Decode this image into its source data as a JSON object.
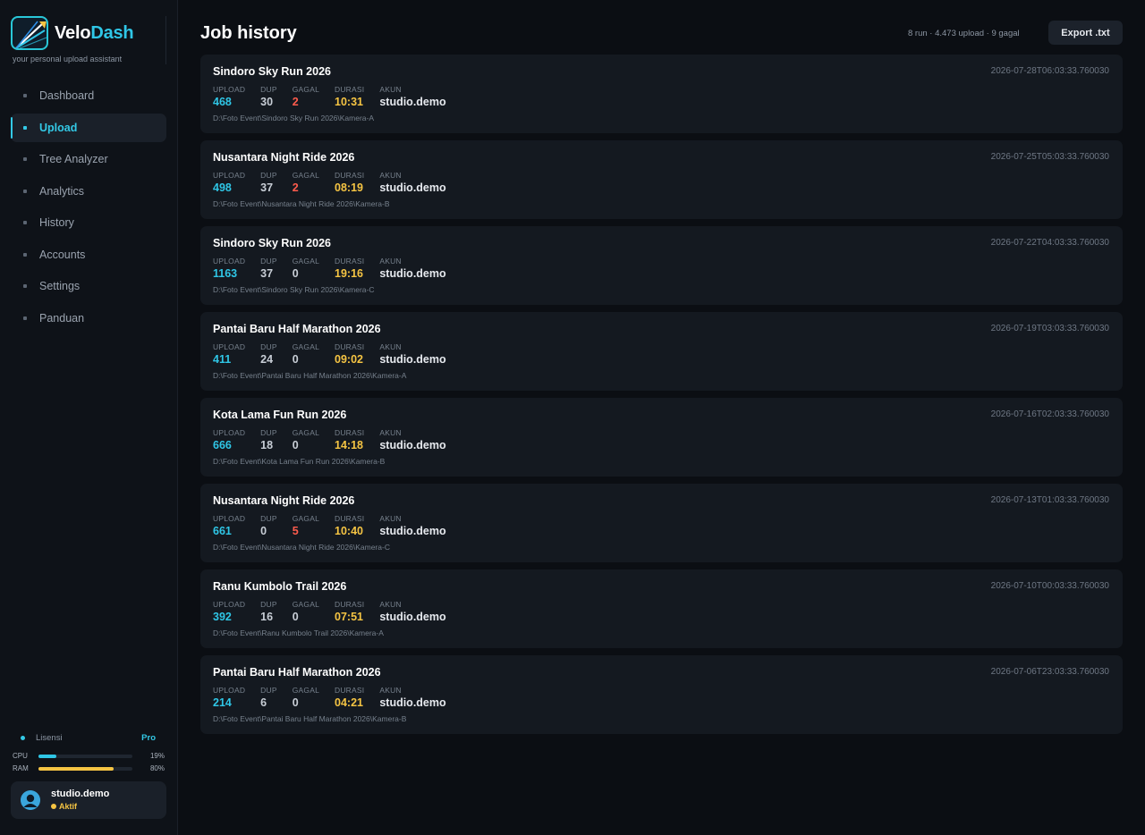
{
  "brand": {
    "name_part1": "Velo",
    "name_part2": "Dash",
    "tagline": "your personal upload assistant"
  },
  "nav": [
    {
      "label": "Dashboard",
      "active": false
    },
    {
      "label": "Upload",
      "active": true
    },
    {
      "label": "Tree Analyzer",
      "active": false
    },
    {
      "label": "Analytics",
      "active": false
    },
    {
      "label": "History",
      "active": false
    },
    {
      "label": "Accounts",
      "active": false
    },
    {
      "label": "Settings",
      "active": false
    },
    {
      "label": "Panduan",
      "active": false
    }
  ],
  "license": {
    "label": "Lisensi",
    "tier": "Pro"
  },
  "system": {
    "cpu": {
      "label": "CPU",
      "percent_text": "19%",
      "fraction": 0.19,
      "color": "#2fc6e6"
    },
    "ram": {
      "label": "RAM",
      "percent_text": "80%",
      "fraction": 0.8,
      "color": "#f5c443"
    }
  },
  "user": {
    "name": "studio.demo",
    "status": "Aktif"
  },
  "header": {
    "title": "Job history",
    "summary": "8 run · 4.473 upload · 9 gagal",
    "export_label": "Export .txt"
  },
  "stat_labels": {
    "upload": "UPLOAD",
    "dup": "DUP",
    "gagal": "GAGAL",
    "durasi": "DURASI",
    "akun": "AKUN"
  },
  "jobs": [
    {
      "title": "Sindoro Sky Run 2026",
      "timestamp": "2026-07-28T06:03:33.760030",
      "upload": "468",
      "dup": "30",
      "gagal": "2",
      "durasi": "10:31",
      "akun": "studio.demo",
      "path": "D:\\Foto Event\\Sindoro Sky Run 2026\\Kamera-A"
    },
    {
      "title": "Nusantara Night Ride 2026",
      "timestamp": "2026-07-25T05:03:33.760030",
      "upload": "498",
      "dup": "37",
      "gagal": "2",
      "durasi": "08:19",
      "akun": "studio.demo",
      "path": "D:\\Foto Event\\Nusantara Night Ride 2026\\Kamera-B"
    },
    {
      "title": "Sindoro Sky Run 2026",
      "timestamp": "2026-07-22T04:03:33.760030",
      "upload": "1163",
      "dup": "37",
      "gagal": "0",
      "durasi": "19:16",
      "akun": "studio.demo",
      "path": "D:\\Foto Event\\Sindoro Sky Run 2026\\Kamera-C"
    },
    {
      "title": "Pantai Baru Half Marathon 2026",
      "timestamp": "2026-07-19T03:03:33.760030",
      "upload": "411",
      "dup": "24",
      "gagal": "0",
      "durasi": "09:02",
      "akun": "studio.demo",
      "path": "D:\\Foto Event\\Pantai Baru Half Marathon 2026\\Kamera-A"
    },
    {
      "title": "Kota Lama Fun Run 2026",
      "timestamp": "2026-07-16T02:03:33.760030",
      "upload": "666",
      "dup": "18",
      "gagal": "0",
      "durasi": "14:18",
      "akun": "studio.demo",
      "path": "D:\\Foto Event\\Kota Lama Fun Run 2026\\Kamera-B"
    },
    {
      "title": "Nusantara Night Ride 2026",
      "timestamp": "2026-07-13T01:03:33.760030",
      "upload": "661",
      "dup": "0",
      "gagal": "5",
      "durasi": "10:40",
      "akun": "studio.demo",
      "path": "D:\\Foto Event\\Nusantara Night Ride 2026\\Kamera-C"
    },
    {
      "title": "Ranu Kumbolo Trail 2026",
      "timestamp": "2026-07-10T00:03:33.760030",
      "upload": "392",
      "dup": "16",
      "gagal": "0",
      "durasi": "07:51",
      "akun": "studio.demo",
      "path": "D:\\Foto Event\\Ranu Kumbolo Trail 2026\\Kamera-A"
    },
    {
      "title": "Pantai Baru Half Marathon 2026",
      "timestamp": "2026-07-06T23:03:33.760030",
      "upload": "214",
      "dup": "6",
      "gagal": "0",
      "durasi": "04:21",
      "akun": "studio.demo",
      "path": "D:\\Foto Event\\Pantai Baru Half Marathon 2026\\Kamera-B"
    }
  ],
  "colors": {
    "accent": "#2fc6e6",
    "warning": "#f5c443",
    "error": "#ff5c4d"
  }
}
